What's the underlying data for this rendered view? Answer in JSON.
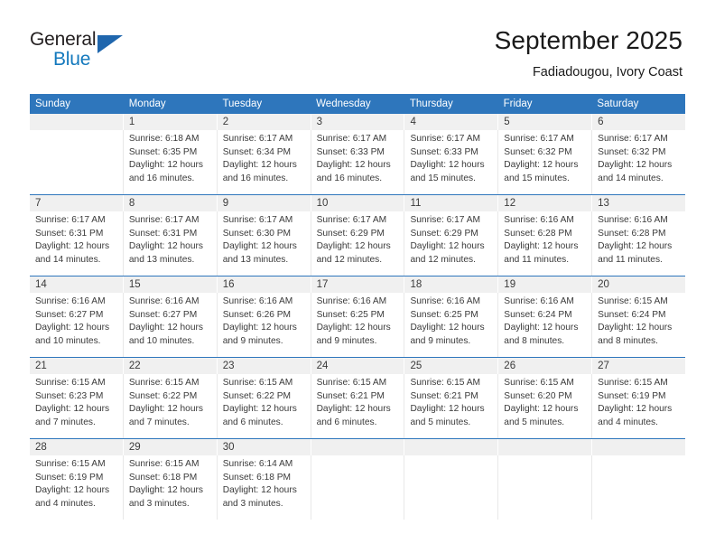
{
  "brand": {
    "name_top": "General",
    "name_bottom": "Blue",
    "accent_color": "#1479bd",
    "triangle_color": "#1f66ad"
  },
  "header": {
    "title": "September 2025",
    "subtitle": "Fadiadougou, Ivory Coast"
  },
  "theme": {
    "header_row_bg": "#2e76bc",
    "daynum_bg": "#f0f0f0",
    "cell_bg": "#ffffff",
    "text_color": "#3a3a3a"
  },
  "weekdays": [
    "Sunday",
    "Monday",
    "Tuesday",
    "Wednesday",
    "Thursday",
    "Friday",
    "Saturday"
  ],
  "weeks": [
    {
      "days": [
        {
          "num": "",
          "sunrise": "",
          "sunset": "",
          "daylight1": "",
          "daylight2": ""
        },
        {
          "num": "1",
          "sunrise": "Sunrise: 6:18 AM",
          "sunset": "Sunset: 6:35 PM",
          "daylight1": "Daylight: 12 hours",
          "daylight2": "and 16 minutes."
        },
        {
          "num": "2",
          "sunrise": "Sunrise: 6:17 AM",
          "sunset": "Sunset: 6:34 PM",
          "daylight1": "Daylight: 12 hours",
          "daylight2": "and 16 minutes."
        },
        {
          "num": "3",
          "sunrise": "Sunrise: 6:17 AM",
          "sunset": "Sunset: 6:33 PM",
          "daylight1": "Daylight: 12 hours",
          "daylight2": "and 16 minutes."
        },
        {
          "num": "4",
          "sunrise": "Sunrise: 6:17 AM",
          "sunset": "Sunset: 6:33 PM",
          "daylight1": "Daylight: 12 hours",
          "daylight2": "and 15 minutes."
        },
        {
          "num": "5",
          "sunrise": "Sunrise: 6:17 AM",
          "sunset": "Sunset: 6:32 PM",
          "daylight1": "Daylight: 12 hours",
          "daylight2": "and 15 minutes."
        },
        {
          "num": "6",
          "sunrise": "Sunrise: 6:17 AM",
          "sunset": "Sunset: 6:32 PM",
          "daylight1": "Daylight: 12 hours",
          "daylight2": "and 14 minutes."
        }
      ]
    },
    {
      "days": [
        {
          "num": "7",
          "sunrise": "Sunrise: 6:17 AM",
          "sunset": "Sunset: 6:31 PM",
          "daylight1": "Daylight: 12 hours",
          "daylight2": "and 14 minutes."
        },
        {
          "num": "8",
          "sunrise": "Sunrise: 6:17 AM",
          "sunset": "Sunset: 6:31 PM",
          "daylight1": "Daylight: 12 hours",
          "daylight2": "and 13 minutes."
        },
        {
          "num": "9",
          "sunrise": "Sunrise: 6:17 AM",
          "sunset": "Sunset: 6:30 PM",
          "daylight1": "Daylight: 12 hours",
          "daylight2": "and 13 minutes."
        },
        {
          "num": "10",
          "sunrise": "Sunrise: 6:17 AM",
          "sunset": "Sunset: 6:29 PM",
          "daylight1": "Daylight: 12 hours",
          "daylight2": "and 12 minutes."
        },
        {
          "num": "11",
          "sunrise": "Sunrise: 6:17 AM",
          "sunset": "Sunset: 6:29 PM",
          "daylight1": "Daylight: 12 hours",
          "daylight2": "and 12 minutes."
        },
        {
          "num": "12",
          "sunrise": "Sunrise: 6:16 AM",
          "sunset": "Sunset: 6:28 PM",
          "daylight1": "Daylight: 12 hours",
          "daylight2": "and 11 minutes."
        },
        {
          "num": "13",
          "sunrise": "Sunrise: 6:16 AM",
          "sunset": "Sunset: 6:28 PM",
          "daylight1": "Daylight: 12 hours",
          "daylight2": "and 11 minutes."
        }
      ]
    },
    {
      "days": [
        {
          "num": "14",
          "sunrise": "Sunrise: 6:16 AM",
          "sunset": "Sunset: 6:27 PM",
          "daylight1": "Daylight: 12 hours",
          "daylight2": "and 10 minutes."
        },
        {
          "num": "15",
          "sunrise": "Sunrise: 6:16 AM",
          "sunset": "Sunset: 6:27 PM",
          "daylight1": "Daylight: 12 hours",
          "daylight2": "and 10 minutes."
        },
        {
          "num": "16",
          "sunrise": "Sunrise: 6:16 AM",
          "sunset": "Sunset: 6:26 PM",
          "daylight1": "Daylight: 12 hours",
          "daylight2": "and 9 minutes."
        },
        {
          "num": "17",
          "sunrise": "Sunrise: 6:16 AM",
          "sunset": "Sunset: 6:25 PM",
          "daylight1": "Daylight: 12 hours",
          "daylight2": "and 9 minutes."
        },
        {
          "num": "18",
          "sunrise": "Sunrise: 6:16 AM",
          "sunset": "Sunset: 6:25 PM",
          "daylight1": "Daylight: 12 hours",
          "daylight2": "and 9 minutes."
        },
        {
          "num": "19",
          "sunrise": "Sunrise: 6:16 AM",
          "sunset": "Sunset: 6:24 PM",
          "daylight1": "Daylight: 12 hours",
          "daylight2": "and 8 minutes."
        },
        {
          "num": "20",
          "sunrise": "Sunrise: 6:15 AM",
          "sunset": "Sunset: 6:24 PM",
          "daylight1": "Daylight: 12 hours",
          "daylight2": "and 8 minutes."
        }
      ]
    },
    {
      "days": [
        {
          "num": "21",
          "sunrise": "Sunrise: 6:15 AM",
          "sunset": "Sunset: 6:23 PM",
          "daylight1": "Daylight: 12 hours",
          "daylight2": "and 7 minutes."
        },
        {
          "num": "22",
          "sunrise": "Sunrise: 6:15 AM",
          "sunset": "Sunset: 6:22 PM",
          "daylight1": "Daylight: 12 hours",
          "daylight2": "and 7 minutes."
        },
        {
          "num": "23",
          "sunrise": "Sunrise: 6:15 AM",
          "sunset": "Sunset: 6:22 PM",
          "daylight1": "Daylight: 12 hours",
          "daylight2": "and 6 minutes."
        },
        {
          "num": "24",
          "sunrise": "Sunrise: 6:15 AM",
          "sunset": "Sunset: 6:21 PM",
          "daylight1": "Daylight: 12 hours",
          "daylight2": "and 6 minutes."
        },
        {
          "num": "25",
          "sunrise": "Sunrise: 6:15 AM",
          "sunset": "Sunset: 6:21 PM",
          "daylight1": "Daylight: 12 hours",
          "daylight2": "and 5 minutes."
        },
        {
          "num": "26",
          "sunrise": "Sunrise: 6:15 AM",
          "sunset": "Sunset: 6:20 PM",
          "daylight1": "Daylight: 12 hours",
          "daylight2": "and 5 minutes."
        },
        {
          "num": "27",
          "sunrise": "Sunrise: 6:15 AM",
          "sunset": "Sunset: 6:19 PM",
          "daylight1": "Daylight: 12 hours",
          "daylight2": "and 4 minutes."
        }
      ]
    },
    {
      "days": [
        {
          "num": "28",
          "sunrise": "Sunrise: 6:15 AM",
          "sunset": "Sunset: 6:19 PM",
          "daylight1": "Daylight: 12 hours",
          "daylight2": "and 4 minutes."
        },
        {
          "num": "29",
          "sunrise": "Sunrise: 6:15 AM",
          "sunset": "Sunset: 6:18 PM",
          "daylight1": "Daylight: 12 hours",
          "daylight2": "and 3 minutes."
        },
        {
          "num": "30",
          "sunrise": "Sunrise: 6:14 AM",
          "sunset": "Sunset: 6:18 PM",
          "daylight1": "Daylight: 12 hours",
          "daylight2": "and 3 minutes."
        },
        {
          "num": "",
          "sunrise": "",
          "sunset": "",
          "daylight1": "",
          "daylight2": ""
        },
        {
          "num": "",
          "sunrise": "",
          "sunset": "",
          "daylight1": "",
          "daylight2": ""
        },
        {
          "num": "",
          "sunrise": "",
          "sunset": "",
          "daylight1": "",
          "daylight2": ""
        },
        {
          "num": "",
          "sunrise": "",
          "sunset": "",
          "daylight1": "",
          "daylight2": ""
        }
      ]
    }
  ]
}
